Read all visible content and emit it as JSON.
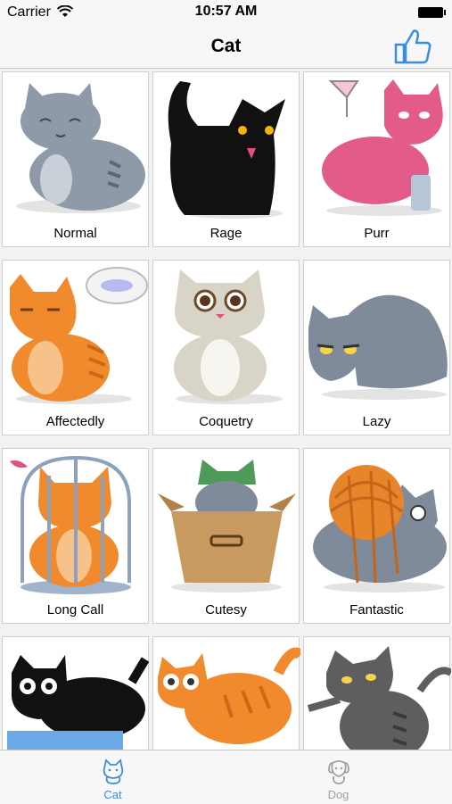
{
  "status_bar": {
    "carrier": "Carrier",
    "time": "10:57 AM"
  },
  "nav": {
    "title": "Cat",
    "like_icon": "thumbs-up-icon"
  },
  "grid": {
    "items": [
      {
        "label": "Normal",
        "color": "#8f9aa8"
      },
      {
        "label": "Rage",
        "color": "#111111"
      },
      {
        "label": "Purr",
        "color": "#e25b8a"
      },
      {
        "label": "Affectedly",
        "color": "#f08a2c"
      },
      {
        "label": "Coquetry",
        "color": "#d9d4c8"
      },
      {
        "label": "Lazy",
        "color": "#7f8b9a"
      },
      {
        "label": "Long Call",
        "color": "#f08a2c"
      },
      {
        "label": "Cutesy",
        "color": "#7f8b9a"
      },
      {
        "label": "Fantastic",
        "color": "#7f8b9a"
      },
      {
        "label": "",
        "color": "#111111"
      },
      {
        "label": "",
        "color": "#f08a2c"
      },
      {
        "label": "",
        "color": "#5e5e5e"
      }
    ]
  },
  "tabs": [
    {
      "label": "Cat",
      "icon": "cat-icon",
      "active": true
    },
    {
      "label": "Dog",
      "icon": "dog-icon",
      "active": false
    }
  ],
  "colors": {
    "accent": "#3b8de0",
    "inactive": "#a0a0a0"
  }
}
